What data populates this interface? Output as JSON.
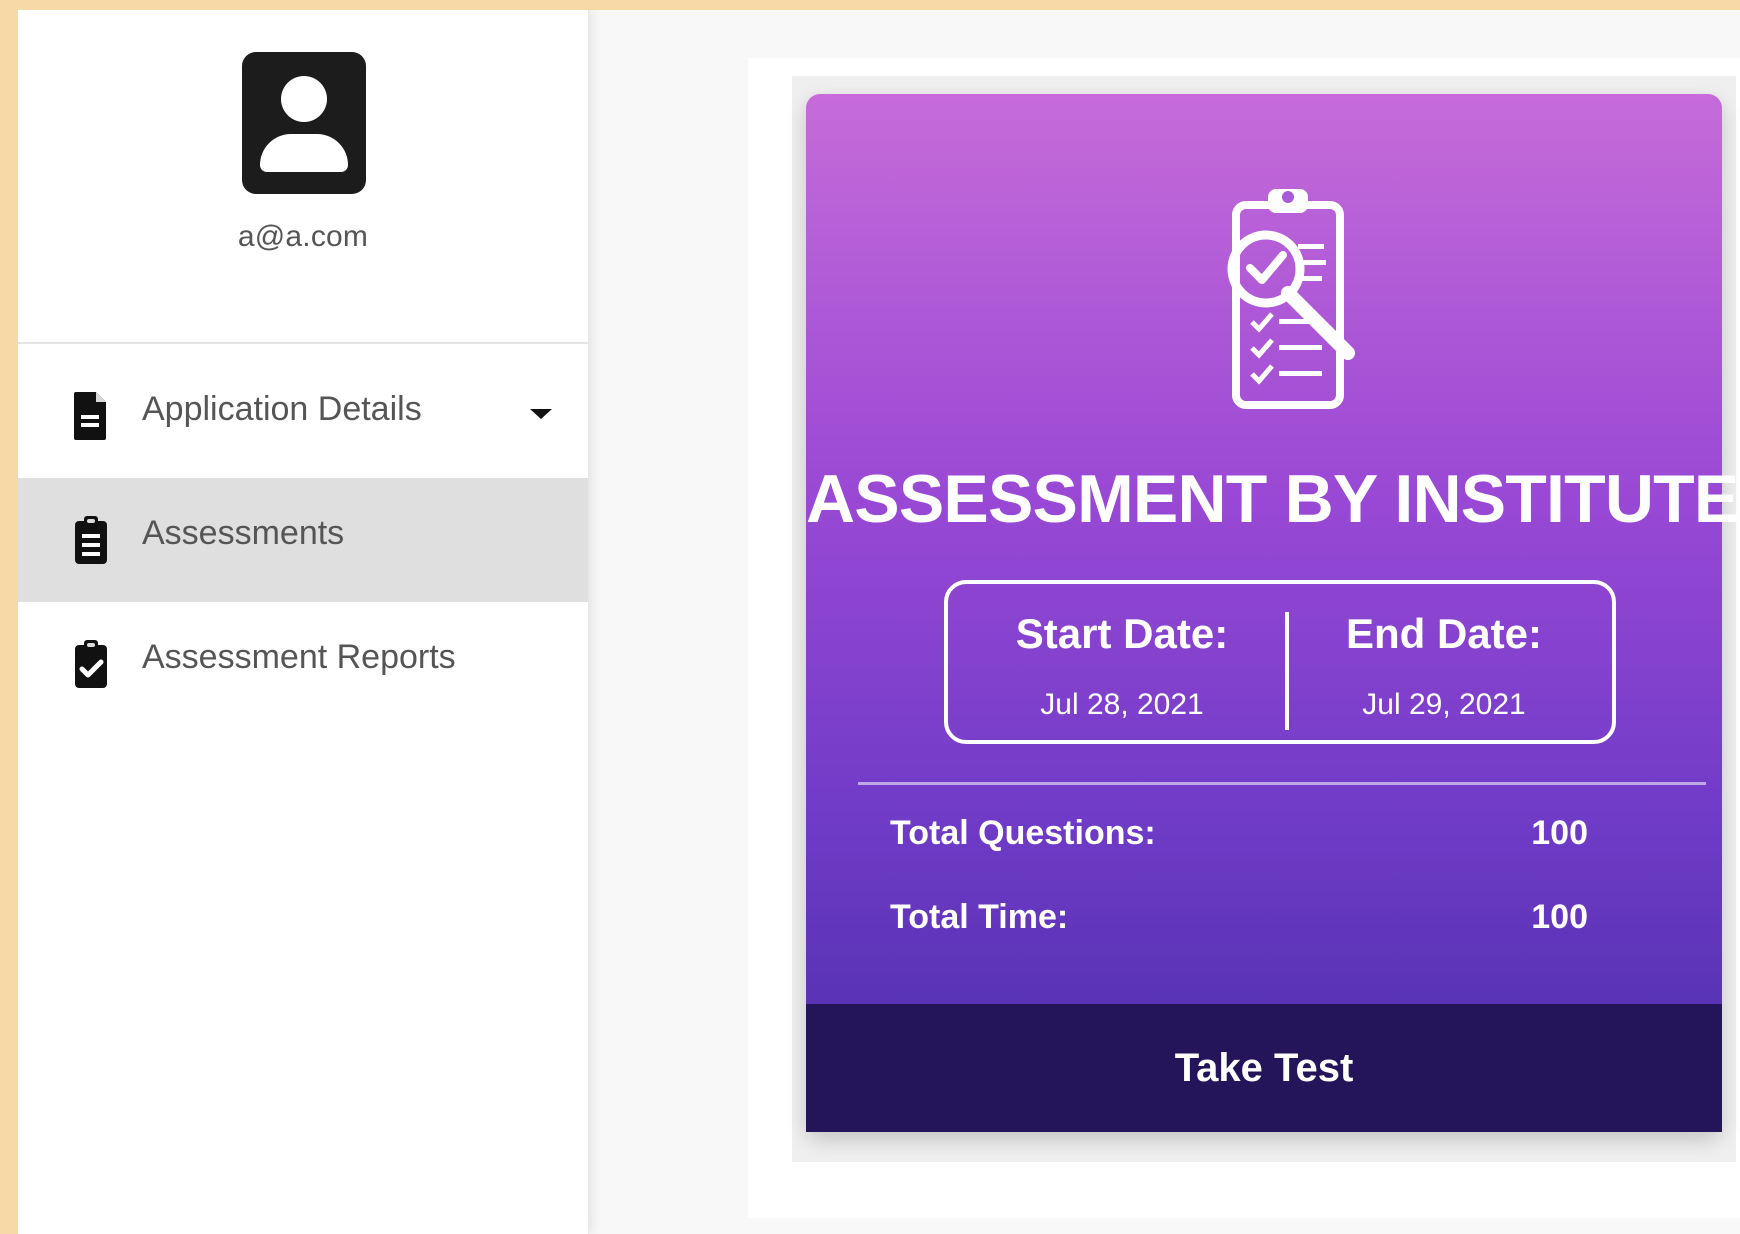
{
  "user": {
    "email": "a@a.com"
  },
  "sidebar": {
    "items": [
      {
        "label": "Application Details",
        "icon": "document-icon"
      },
      {
        "label": "Assessments",
        "icon": "clipboard-list-icon"
      },
      {
        "label": "Assessment Reports",
        "icon": "clipboard-check-icon"
      }
    ],
    "active_item": "Assessments"
  },
  "assessment_card": {
    "title": "ASSESSMENT BY INSTITUTE",
    "start_date_label": "Start Date:",
    "start_date": "Jul 28, 2021",
    "end_date_label": "End Date:",
    "end_date": "Jul 29, 2021",
    "total_questions_label": "Total Questions:",
    "total_questions": "100",
    "total_time_label": "Total Time:",
    "total_time": "100",
    "action_label": "Take Test"
  },
  "colors": {
    "page_background": "#f7d9a8",
    "sidebar_active": "#dfdfdf",
    "card_top": "#c66bd9",
    "card_bottom": "#4a2ea8",
    "button_background": "#24155a"
  }
}
